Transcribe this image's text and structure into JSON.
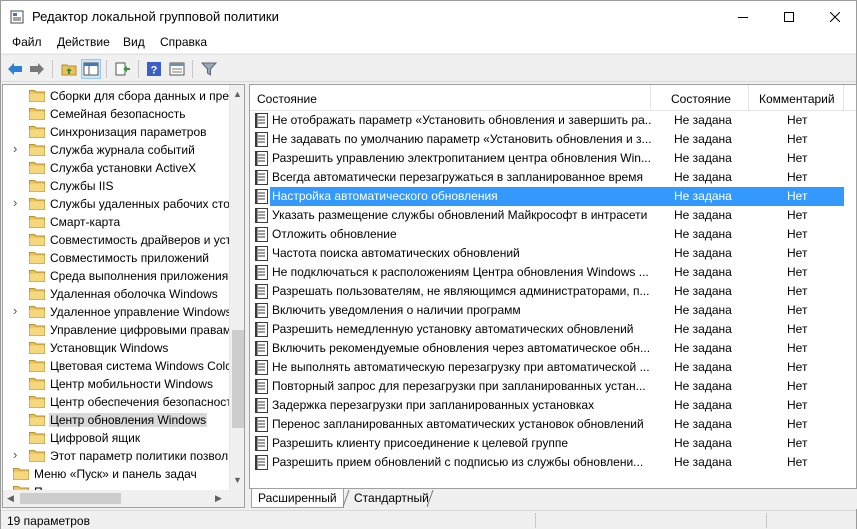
{
  "window": {
    "title": "Редактор локальной групповой политики"
  },
  "menu": [
    "Файл",
    "Действие",
    "Вид",
    "Справка"
  ],
  "tree": {
    "items": [
      {
        "label": "Сборки для сбора данных и пре",
        "expandable": false,
        "level": 2
      },
      {
        "label": "Семейная безопасность",
        "expandable": false,
        "level": 2
      },
      {
        "label": "Синхронизация параметров",
        "expandable": false,
        "level": 2
      },
      {
        "label": "Служба журнала событий",
        "expandable": true,
        "level": 2
      },
      {
        "label": "Служба установки ActiveX",
        "expandable": false,
        "level": 2
      },
      {
        "label": "Службы IIS",
        "expandable": false,
        "level": 2
      },
      {
        "label": "Службы удаленных рабочих сто",
        "expandable": true,
        "level": 2
      },
      {
        "label": "Смарт-карта",
        "expandable": false,
        "level": 2
      },
      {
        "label": "Совместимость драйверов и уст",
        "expandable": false,
        "level": 2
      },
      {
        "label": "Совместимость приложений",
        "expandable": false,
        "level": 2
      },
      {
        "label": "Среда выполнения приложения",
        "expandable": false,
        "level": 2
      },
      {
        "label": "Удаленная оболочка Windows",
        "expandable": false,
        "level": 2
      },
      {
        "label": "Удаленное управление Windows",
        "expandable": true,
        "level": 2
      },
      {
        "label": "Управление цифровыми правам",
        "expandable": false,
        "level": 2
      },
      {
        "label": "Установщик Windows",
        "expandable": false,
        "level": 2
      },
      {
        "label": "Цветовая система Windows Colc",
        "expandable": false,
        "level": 2
      },
      {
        "label": "Центр мобильности Windows",
        "expandable": false,
        "level": 2
      },
      {
        "label": "Центр обеспечения безопасност",
        "expandable": false,
        "level": 2
      },
      {
        "label": "Центр обновления Windows",
        "expandable": false,
        "level": 2,
        "selected": true
      },
      {
        "label": "Цифровой ящик",
        "expandable": false,
        "level": 2
      },
      {
        "label": "Этот параметр политики позвол",
        "expandable": true,
        "level": 2
      },
      {
        "label": "Меню «Пуск» и панель задач",
        "expandable": true,
        "level": 1
      },
      {
        "label": "П",
        "expandable": false,
        "level": 1
      }
    ]
  },
  "columns": {
    "name": "Состояние",
    "state": "Состояние",
    "comment": "Комментарий"
  },
  "policies": [
    {
      "name": "Не отображать параметр «Установить обновления и завершить ра...",
      "state": "Не задана",
      "comment": "Нет"
    },
    {
      "name": "Не задавать по умолчанию параметр «Установить обновления и з...",
      "state": "Не задана",
      "comment": "Нет"
    },
    {
      "name": "Разрешить управлению электропитанием центра обновления Win...",
      "state": "Не задана",
      "comment": "Нет"
    },
    {
      "name": "Всегда автоматически перезагружаться в запланированное время",
      "state": "Не задана",
      "comment": "Нет"
    },
    {
      "name": "Настройка автоматического обновления",
      "state": "Не задана",
      "comment": "Нет",
      "selected": true
    },
    {
      "name": "Указать размещение службы обновлений Майкрософт в интрасети",
      "state": "Не задана",
      "comment": "Нет"
    },
    {
      "name": "Отложить обновление",
      "state": "Не задана",
      "comment": "Нет"
    },
    {
      "name": "Частота поиска автоматических обновлений",
      "state": "Не задана",
      "comment": "Нет"
    },
    {
      "name": "Не подключаться к расположениям Центра обновления Windows ...",
      "state": "Не задана",
      "comment": "Нет"
    },
    {
      "name": "Разрешать пользователям, не являющимся администраторами, п...",
      "state": "Не задана",
      "comment": "Нет"
    },
    {
      "name": "Включить уведомления о наличии программ",
      "state": "Не задана",
      "comment": "Нет"
    },
    {
      "name": "Разрешить немедленную установку автоматических обновлений",
      "state": "Не задана",
      "comment": "Нет"
    },
    {
      "name": "Включить рекомендуемые обновления через автоматическое обн...",
      "state": "Не задана",
      "comment": "Нет"
    },
    {
      "name": "Не выполнять автоматическую перезагрузку при автоматической ...",
      "state": "Не задана",
      "comment": "Нет"
    },
    {
      "name": "Повторный запрос для перезагрузки при запланированных устан...",
      "state": "Не задана",
      "comment": "Нет"
    },
    {
      "name": "Задержка перезагрузки при запланированных установках",
      "state": "Не задана",
      "comment": "Нет"
    },
    {
      "name": "Перенос запланированных автоматических установок обновлений",
      "state": "Не задана",
      "comment": "Нет"
    },
    {
      "name": "Разрешить клиенту присоединение к целевой группе",
      "state": "Не задана",
      "comment": "Нет"
    },
    {
      "name": "Разрешить прием обновлений с подписью из службы обновлени...",
      "state": "Не задана",
      "comment": "Нет"
    }
  ],
  "tabs": [
    "Расширенный",
    "Стандартный"
  ],
  "status": {
    "text": "19 параметров"
  },
  "colors": {
    "selection": "#3399ff",
    "folder": "#e8c25c",
    "tree_selection": "#d9d9d9"
  }
}
